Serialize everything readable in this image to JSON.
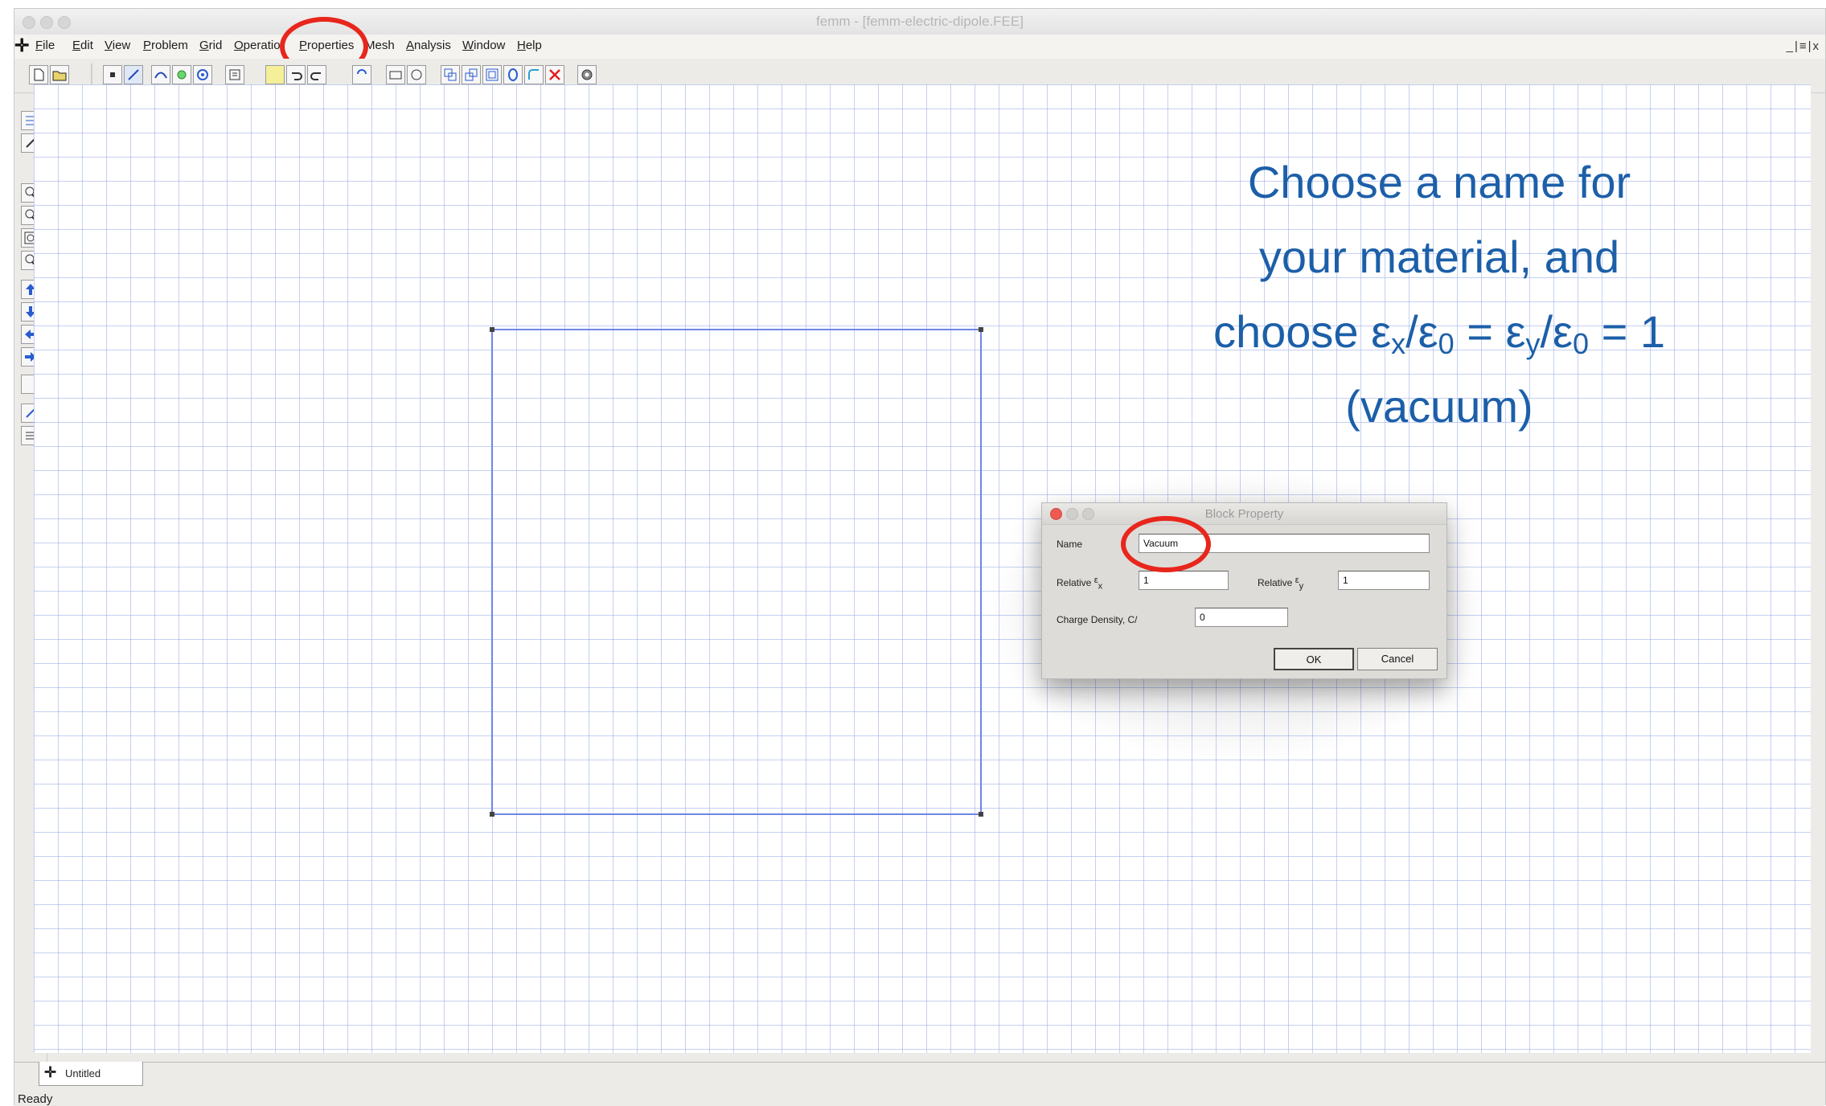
{
  "window": {
    "title": "femm - [femm-electric-dipole.FEE]"
  },
  "menubar": {
    "items": [
      {
        "label": "File",
        "u": "F",
        "rest": "ile"
      },
      {
        "label": "Edit",
        "u": "E",
        "rest": "dit"
      },
      {
        "label": "View",
        "u": "V",
        "rest": "iew"
      },
      {
        "label": "Problem",
        "u": "P",
        "rest": "roblem"
      },
      {
        "label": "Grid",
        "u": "G",
        "rest": "rid"
      },
      {
        "label": "Operation",
        "u": "O",
        "rest": "peratio"
      },
      {
        "label": "Properties",
        "u": "P",
        "rest": "roperties"
      },
      {
        "label": "Mesh",
        "u": "",
        "rest": "Mesh"
      },
      {
        "label": "Analysis",
        "u": "A",
        "rest": "nalysis"
      },
      {
        "label": "Window",
        "u": "W",
        "rest": "indow"
      },
      {
        "label": "Help",
        "u": "H",
        "rest": "elp"
      }
    ],
    "mdi_controls": "_|≡|x"
  },
  "toolbar": {
    "icons": [
      "new-file-icon",
      "open-folder-icon",
      "node-mode-icon",
      "segment-mode-icon",
      "arc-mode-icon",
      "block-label-mode-icon",
      "group-mode-icon",
      "properties-icon",
      "fill-icon",
      "undo-icon",
      "redo-icon",
      "select-window-icon",
      "select-circle-icon",
      "copy-icon",
      "move-icon",
      "scale-icon",
      "mirror-icon",
      "fillet-icon",
      "delete-icon",
      "mesh-icon"
    ]
  },
  "vtoolbar": {
    "icons": [
      "show-mesh-icon",
      "hide-mesh-icon",
      "zoom-in-icon",
      "zoom-out-icon",
      "zoom-natural-icon",
      "zoom-window-icon",
      "pan-up-icon",
      "pan-down-icon",
      "pan-left-icon",
      "pan-right-icon",
      "blank-icon",
      "snap-icon",
      "grid-settings-icon"
    ]
  },
  "tabs": [
    {
      "label": "Untitled"
    }
  ],
  "status": {
    "text": "Ready"
  },
  "dialog": {
    "title": "Block Property",
    "name_label": "Name",
    "name_value": "Vacuum",
    "rel_x_label": "Relative ",
    "rel_y_label": "Relative ",
    "epsilon_symbol": "ε",
    "x_sub": "x",
    "y_sub": "y",
    "rel_x_value": "1",
    "rel_y_value": "1",
    "charge_label": "Charge Density, C/",
    "charge_value": "0",
    "ok_label": "OK",
    "cancel_label": "Cancel"
  },
  "annotation": {
    "line1": "Choose a name for",
    "line2": "your material, and",
    "line3_a": "choose ε",
    "sub_x": "x",
    "line3_b": "/ε",
    "sub_0a": "0",
    "line3_c": " = ε",
    "sub_y": "y",
    "line3_d": "/ε",
    "sub_0b": "0",
    "line3_e": " = 1",
    "line4": "(vacuum)"
  },
  "colors": {
    "annotation_text": "#1c5fa8",
    "highlight_ring": "#e8261c",
    "geometry_line": "#6f86e6",
    "grid_dots": "#96aae6"
  }
}
